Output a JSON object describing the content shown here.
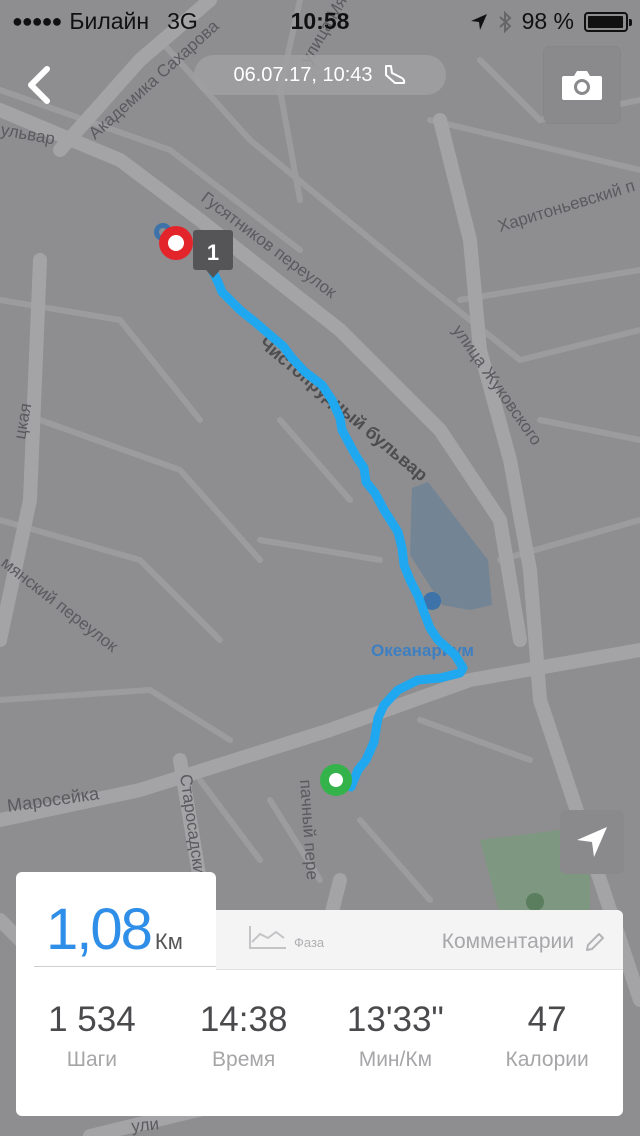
{
  "status_bar": {
    "signal": "●●●●●",
    "carrier": "Билайн",
    "network": "3G",
    "time": "10:58",
    "battery_text": "98 %",
    "battery_level": 0.98
  },
  "header": {
    "date_label": "06.07.17, 10:43",
    "back_icon": "chevron-left-icon",
    "activity_icon": "shoe-icon",
    "camera_icon": "camera-icon"
  },
  "map": {
    "street_labels": {
      "sakharova": "Академика Сахарова",
      "myasnitskaya": "улица Мясницкая",
      "bulvar": "ульвар",
      "gusyatnikov": "Гусятников переулок",
      "kharitonyevsky": "Харитоньевский п",
      "zhukovskogo": "улица Жуковского",
      "chistoprudny": "Чистопрудный бульвар",
      "tskaya": "цкая",
      "yanskiy": "мянский переулок",
      "maroseyka": "Маросейка",
      "starosadskiy": "Старосадский п",
      "pachny": "пачный пере",
      "ulits": "ули"
    },
    "poi_label": "Океанариум",
    "lap_marker": "1",
    "route_color": "#1fa7ef",
    "start_color": "#34b34a",
    "end_color": "#e3252b"
  },
  "summary": {
    "distance_value": "1,08",
    "distance_unit": "Км",
    "phase_tab_label": "Фаза",
    "comments_tab_label": "Комментарии",
    "stats": [
      {
        "value": "1 534",
        "label": "Шаги"
      },
      {
        "value": "14:38",
        "label": "Время"
      },
      {
        "value": "13'33\"",
        "label": "Мин/Км"
      },
      {
        "value": "47",
        "label": "Калории"
      }
    ]
  }
}
